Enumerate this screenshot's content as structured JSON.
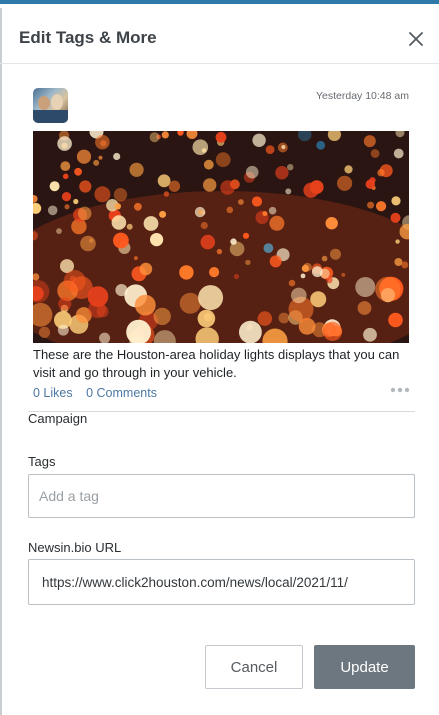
{
  "dialog": {
    "title": "Edit Tags & More",
    "close_icon": "close-icon"
  },
  "post": {
    "timestamp": "Yesterday 10:48 am",
    "caption": "These are the Houston-area holiday lights displays that you can visit and go through in your vehicle.",
    "likes": "0 Likes",
    "comments": "0 Comments",
    "more_icon": "more-dots-icon"
  },
  "form": {
    "campaign_label": "Campaign",
    "tags_label": "Tags",
    "tags_placeholder": "Add a tag",
    "url_label": "Newsin.bio URL",
    "url_value": "https://www.click2houston.com/news/local/2021/11/"
  },
  "buttons": {
    "cancel": "Cancel",
    "update": "Update"
  },
  "colors": {
    "accent_top": "#2f79a8",
    "link": "#4c78a3",
    "update_button": "#6c7780"
  }
}
